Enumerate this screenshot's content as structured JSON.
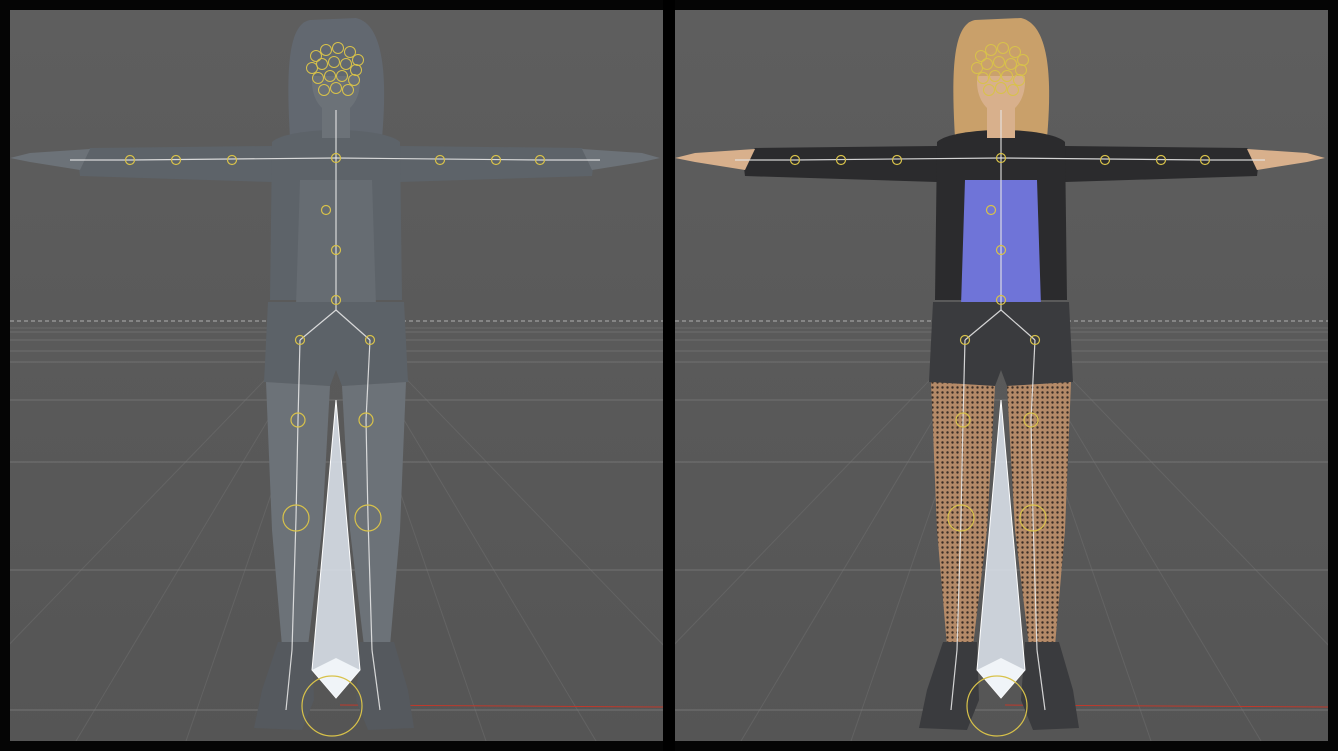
{
  "viewports": [
    {
      "name": "viewport-left",
      "shading": "untextured-gray",
      "colors": {
        "background": "#5a5a5a",
        "skin": "#6c7278",
        "hair": "#626870",
        "jacket": "#5d6369",
        "top": "#666c72",
        "shorts": "#5c6268",
        "legs": "#6c7278",
        "boots": "#55595e"
      },
      "fishnet": false
    },
    {
      "name": "viewport-right",
      "shading": "textured",
      "colors": {
        "background": "#5a5a5a",
        "skin": "#d8b08c",
        "hair": "#c9a06a",
        "jacket": "#2b2b2d",
        "top": "#6f74d8",
        "shorts": "#3a3b3e",
        "legs": "#b48a68",
        "boots": "#3a3b3e"
      },
      "fishnet": true
    }
  ],
  "rig_colors": {
    "bone": "#e6e6e6",
    "joint": "#d8c24a",
    "ground_bone": "#dfe6f0",
    "grid_line": "#7a7a7a",
    "horizon_dash": "#b0b0b0",
    "axis_x": "#c0392b"
  }
}
